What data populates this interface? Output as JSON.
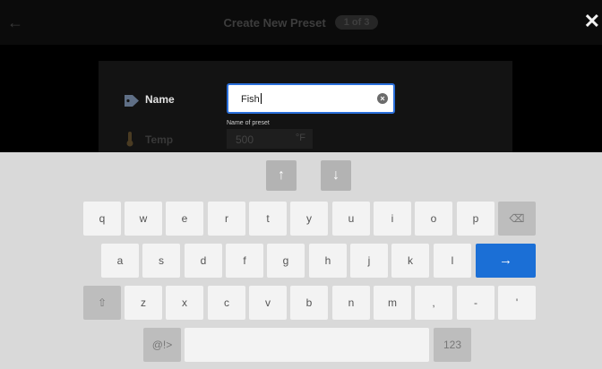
{
  "header": {
    "back_icon": "arrow-left-icon",
    "title": "Create New Preset",
    "step": "1 of 3",
    "close_glyph": "✕"
  },
  "form": {
    "name_label": "Name",
    "name_icon": "tag-icon",
    "name_value": "Fish",
    "clear_glyph": "×",
    "helper_text": "Name of preset",
    "temp_label": "Temp",
    "temp_icon": "thermometer-icon",
    "temp_value": "500",
    "temp_unit": "°F"
  },
  "keyboard": {
    "nav": {
      "up": "↑",
      "down": "↓"
    },
    "row1": [
      "q",
      "w",
      "e",
      "r",
      "t",
      "y",
      "u",
      "i",
      "o",
      "p"
    ],
    "backspace_glyph": "⌫",
    "row2": [
      "a",
      "s",
      "d",
      "f",
      "g",
      "h",
      "j",
      "k",
      "l"
    ],
    "enter_glyph": "→",
    "shift_glyph": "⇧",
    "row3": [
      "z",
      "x",
      "c",
      "v",
      "b",
      "n",
      "m",
      ",",
      "-",
      "'"
    ],
    "symbols_label": "@!>",
    "numbers_label": "123",
    "accent_color": "#1b6fd6"
  }
}
